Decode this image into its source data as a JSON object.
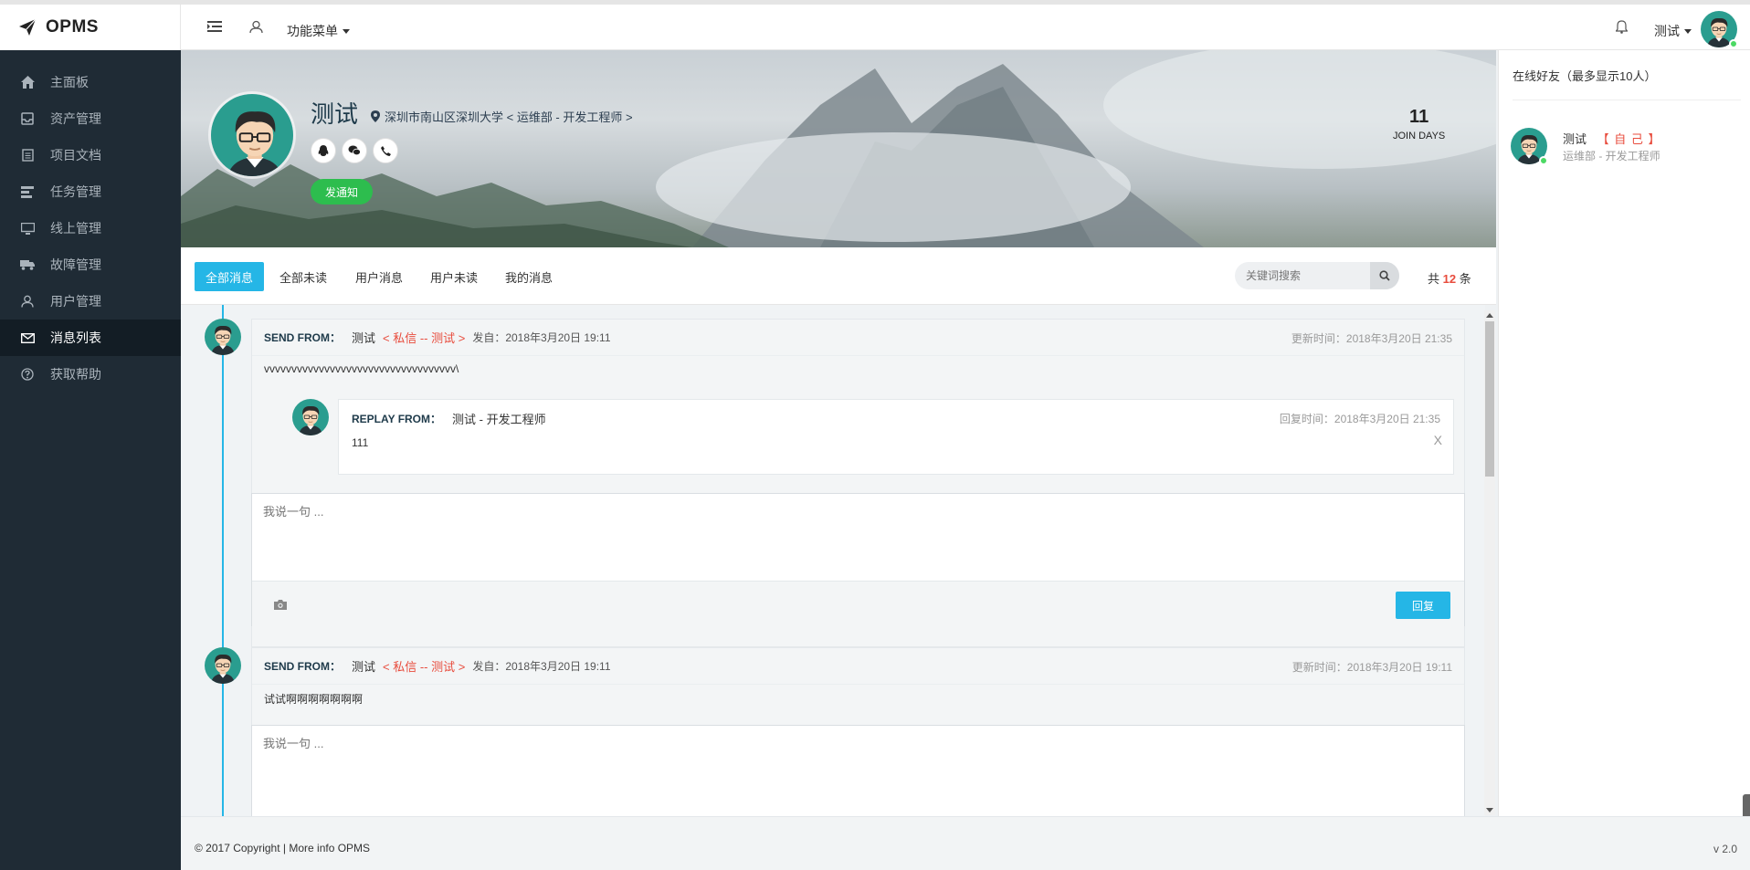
{
  "brand": {
    "name": "OPMS"
  },
  "header": {
    "menu_label": "功能菜单",
    "user_name": "测试"
  },
  "sidebar": {
    "items": [
      {
        "label": "主面板",
        "icon": "home-icon"
      },
      {
        "label": "资产管理",
        "icon": "inbox-icon"
      },
      {
        "label": "项目文档",
        "icon": "doc-icon"
      },
      {
        "label": "任务管理",
        "icon": "tasks-icon"
      },
      {
        "label": "线上管理",
        "icon": "monitor-icon"
      },
      {
        "label": "故障管理",
        "icon": "truck-icon"
      },
      {
        "label": "用户管理",
        "icon": "user-icon"
      },
      {
        "label": "消息列表",
        "icon": "envelope-icon",
        "active": true
      },
      {
        "label": "获取帮助",
        "icon": "help-icon"
      }
    ]
  },
  "profile": {
    "name": "测试",
    "location": "深圳市南山区深圳大学 < 运维部 - 开发工程师 >",
    "notify_label": "发通知",
    "join_days": "11",
    "join_label": "JOIN DAYS"
  },
  "tabs": [
    "全部消息",
    "全部未读",
    "用户消息",
    "用户未读",
    "我的消息"
  ],
  "search": {
    "placeholder": "关键词搜索"
  },
  "total": {
    "prefix": "共",
    "count": "12",
    "suffix": "条"
  },
  "messages": [
    {
      "send_from_label": "SEND FROM：",
      "sender": "测试",
      "private_tag": "< 私信 -- 测试 >",
      "sent_at": "发自：2018年3月20日 19:11",
      "updated_at": "更新时间：2018年3月20日 21:35",
      "body": "vvvvvvvvvvvvvvvvvvvvvvvvvvvvvvvvvvv\\",
      "reply": {
        "label": "REPLAY FROM：",
        "who": "测试 - 开发工程师",
        "time": "回复时间：2018年3月20日 21:35",
        "body": "111",
        "close": "X"
      },
      "composer_placeholder": "我说一句 ...",
      "reply_button": "回复"
    },
    {
      "send_from_label": "SEND FROM：",
      "sender": "测试",
      "private_tag": "< 私信 -- 测试 >",
      "sent_at": "发自：2018年3月20日 19:11",
      "updated_at": "更新时间：2018年3月20日 19:11",
      "body": "试试啊啊啊啊啊啊啊",
      "composer_placeholder": "我说一句 ..."
    }
  ],
  "footer": {
    "copyright": "© 2017 Copyright | More info OPMS",
    "version": "v 2.0"
  },
  "right_panel": {
    "title": "在线好友（最多显示10人）",
    "friends": [
      {
        "name": "测试",
        "self_tag": "【 自 己 】",
        "role": "运维部 - 开发工程师"
      }
    ]
  },
  "colors": {
    "accent": "#25b6e6",
    "green": "#2dbd4e",
    "danger": "#e84c3d",
    "sidebar_bg": "#1f2b35"
  }
}
